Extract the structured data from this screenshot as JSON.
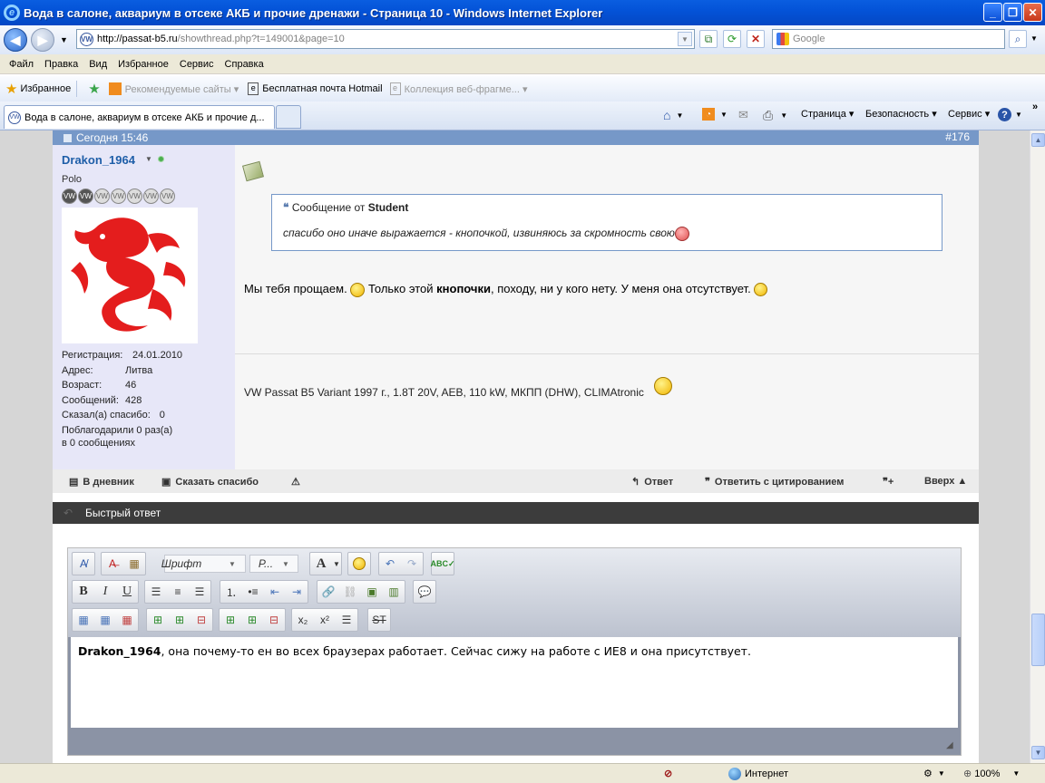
{
  "window": {
    "title": "Вода в салоне, аквариум в отсеке АКБ и прочие дренажи - Страница 10 - Windows Internet Explorer"
  },
  "address": {
    "url_host": "http://passat-b5.ru",
    "url_path": "/showthread.php?t=149001&page=10",
    "search_placeholder": "Google"
  },
  "menu": [
    "Файл",
    "Правка",
    "Вид",
    "Избранное",
    "Сервис",
    "Справка"
  ],
  "favorites": {
    "label": "Избранное",
    "items": [
      "Рекомендуемые сайты ▾",
      "Бесплатная почта Hotmail",
      "Коллекция веб-фрагме... ▾"
    ]
  },
  "tabs": {
    "active": "Вода в салоне, аквариум в отсеке АКБ и прочие д..."
  },
  "commandbar": {
    "page": "Страница ▾",
    "security": "Безопасность ▾",
    "tools": "Сервис ▾"
  },
  "post": {
    "date": "Сегодня 15:46",
    "number": "#176",
    "user": {
      "name": "Drakon_1964",
      "title": "Polo",
      "stats": [
        {
          "k": "Регистрация:",
          "v": "24.01.2010"
        },
        {
          "k": "Адрес:",
          "v": "Литва"
        },
        {
          "k": "Возраст:",
          "v": "46"
        },
        {
          "k": "Сообщений:",
          "v": "428"
        }
      ],
      "thanks_said": "Сказал(а) спасибо:",
      "thanks_said_val": "0",
      "thanks_got": "Поблагодарили 0 раз(а)",
      "thanks_in": "в 0 сообщениях"
    },
    "quote": {
      "prefix": "Сообщение от",
      "author": "Student",
      "text": "спасибо оно иначе выражается - кнопочкой, извиняюсь за скромность свою"
    },
    "message": {
      "part1": "Мы тебя прощаем.",
      "part2": "Только этой",
      "bold": "кнопочки",
      "part3": ", походу, ни у кого нету. У меня она отсутствует."
    },
    "signature": "VW Passat B5 Variant 1997 г., 1.8T 20V, AEB, 110 kW, МКПП (DHW), CLIMAtronic"
  },
  "post_actions": {
    "diary": "В дневник",
    "thanks": "Сказать спасибо",
    "reply": "Ответ",
    "reply_quote": "Ответить с цитированием",
    "top": "Вверх ▲"
  },
  "quick_reply": {
    "title": "Быстрый ответ",
    "font_placeholder": "Шрифт",
    "size_placeholder": "Р...",
    "text_bold": "Drakon_1964",
    "text_rest": ", она почему-то ен во всех браузерах работает. Сейчас сижу на работе с ИЕ8 и она присутствует."
  },
  "status": {
    "zone": "Интернет",
    "zoom": "100%"
  }
}
